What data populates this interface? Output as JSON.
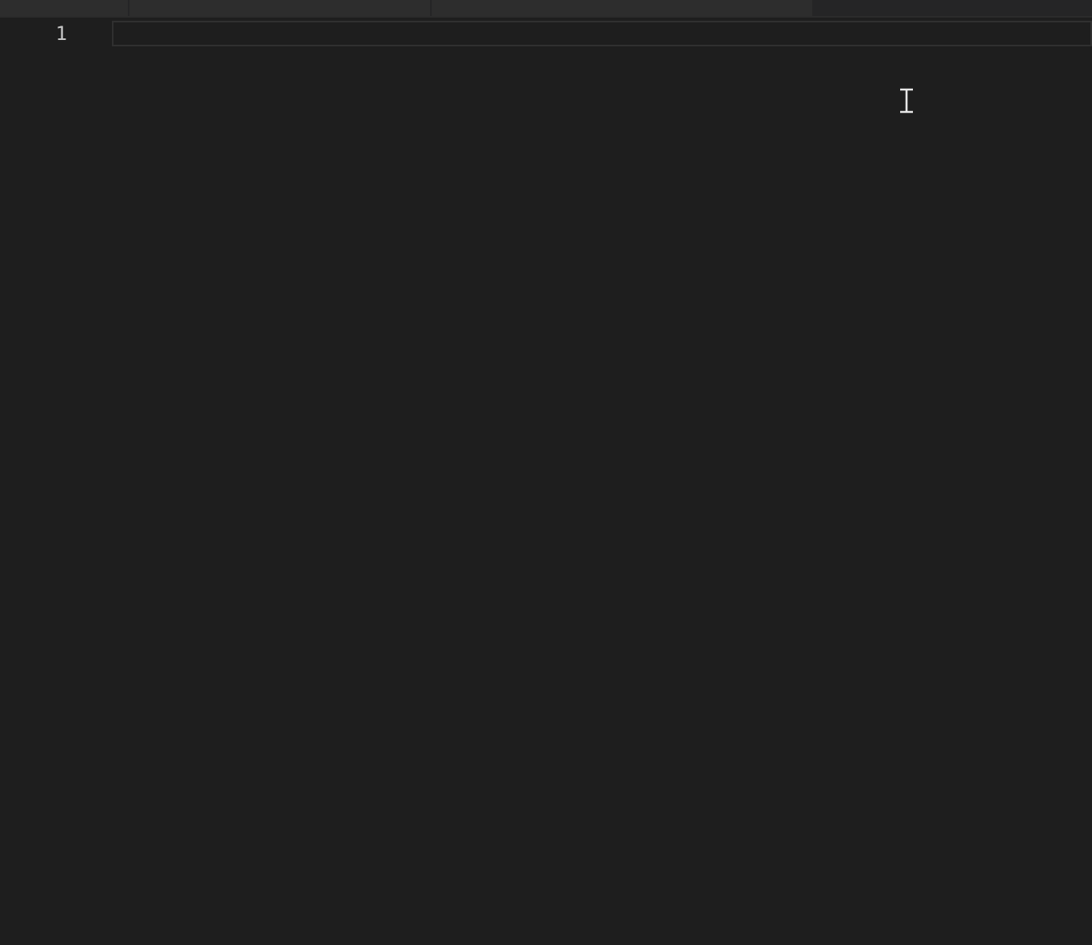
{
  "editor": {
    "lines": [
      {
        "number": "1",
        "current": true
      }
    ]
  }
}
